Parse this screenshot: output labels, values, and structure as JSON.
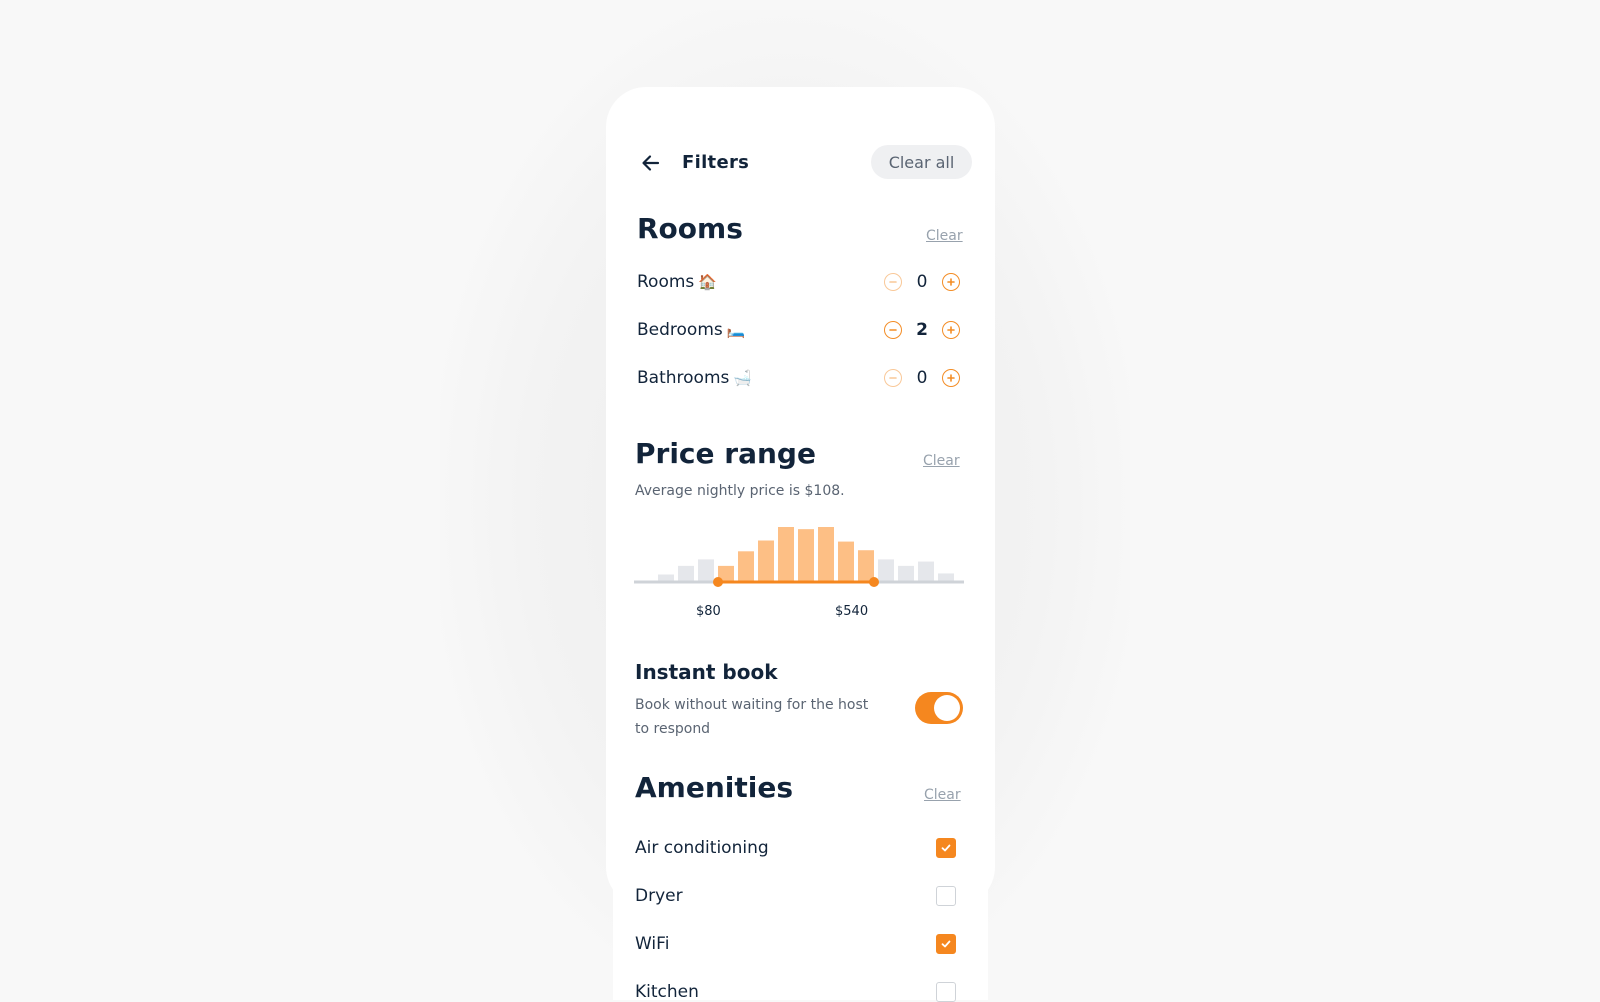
{
  "header": {
    "title": "Filters",
    "clear_all_label": "Clear all"
  },
  "rooms": {
    "title": "Rooms",
    "clear_label": "Clear",
    "counters": [
      {
        "label": "Rooms",
        "emoji": "🏠",
        "value": "0"
      },
      {
        "label": "Bedrooms",
        "emoji": "🛏️",
        "value": "2"
      },
      {
        "label": "Bathrooms",
        "emoji": "🛁",
        "value": "0"
      }
    ]
  },
  "price": {
    "title": "Price range",
    "clear_label": "Clear",
    "subtitle": "Average nightly price is $108.",
    "min_label": "$80",
    "max_label": "$540",
    "histogram": [
      0.12,
      0.28,
      0.4,
      0.28,
      0.55,
      0.75,
      1.0,
      0.96,
      1.0,
      0.73,
      0.57,
      0.4,
      0.28,
      0.36,
      0.14
    ],
    "selected_range": [
      3,
      10
    ],
    "colors": {
      "active": "#fdbf85",
      "inactive": "#e5e7eb",
      "track": "#cfd3d8",
      "accent": "#f5871f"
    }
  },
  "instant_book": {
    "title": "Instant book",
    "description": "Book without waiting for the host to respond",
    "enabled": true
  },
  "amenities": {
    "title": "Amenities",
    "clear_label": "Clear",
    "items": [
      {
        "label": "Air conditioning",
        "checked": true
      },
      {
        "label": "Dryer",
        "checked": false
      },
      {
        "label": "WiFi",
        "checked": true
      },
      {
        "label": "Kitchen",
        "checked": false
      }
    ]
  },
  "icons": {
    "back": "arrow-left-icon",
    "decrement": "minus-icon",
    "increment": "plus-icon",
    "check": "check-icon"
  },
  "accent_color": "#f5871f"
}
